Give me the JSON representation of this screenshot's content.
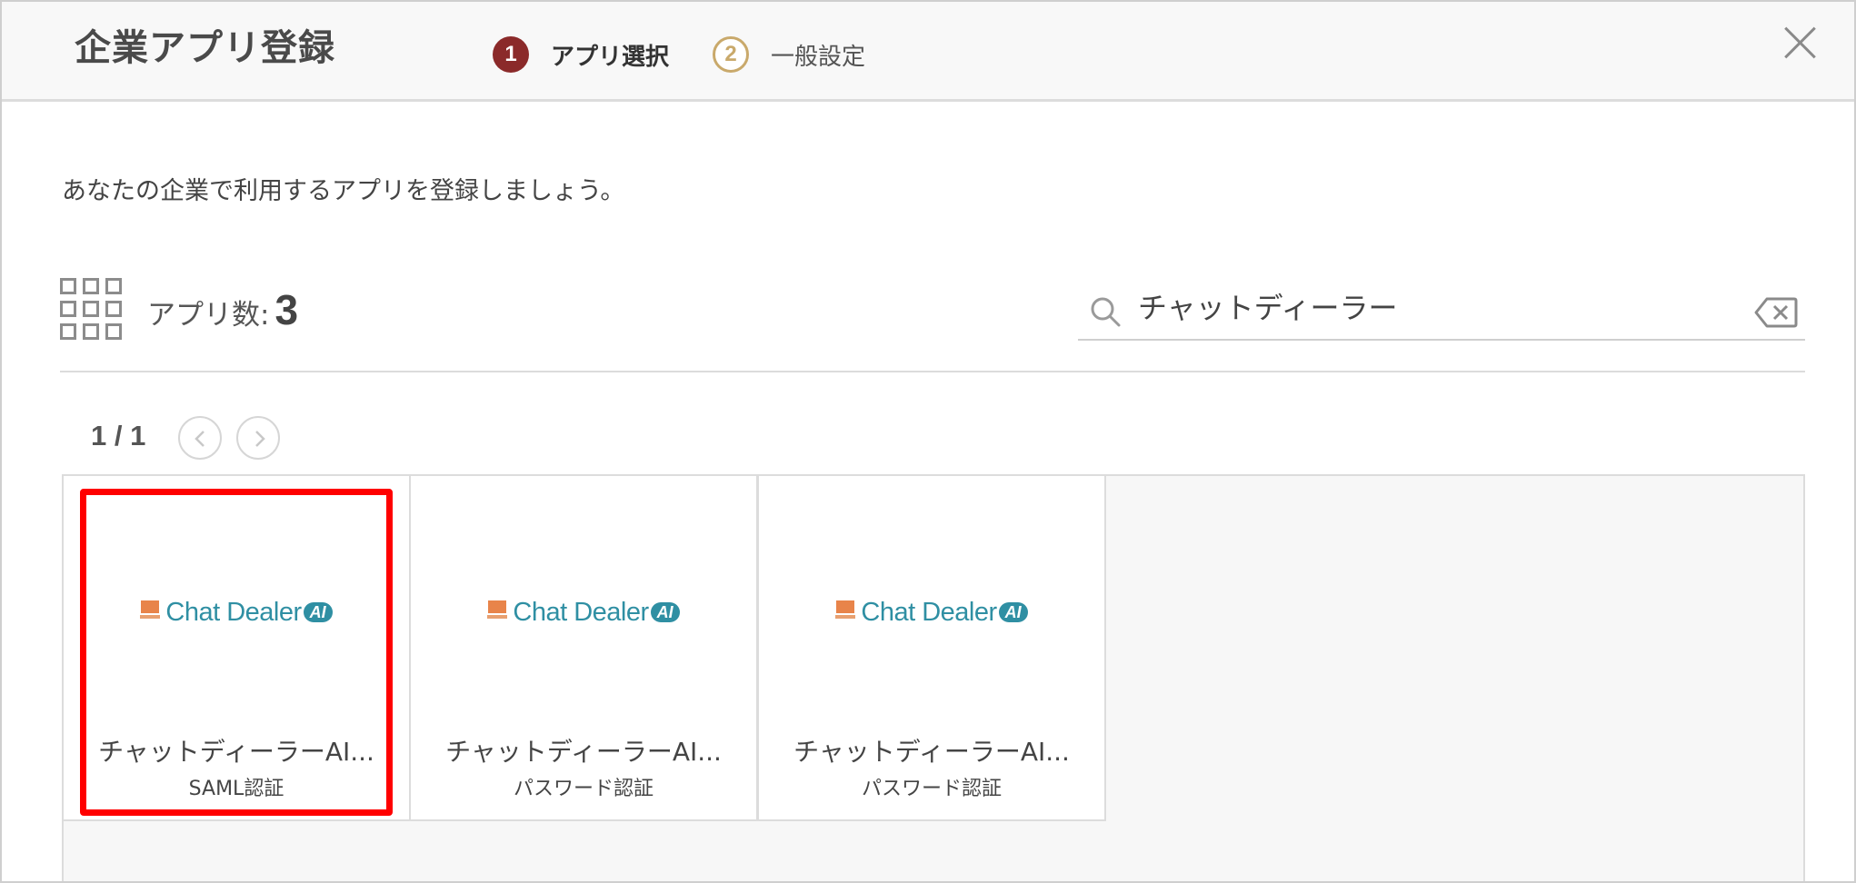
{
  "header": {
    "title": "企業アプリ登録",
    "steps": [
      {
        "number": "1",
        "label": "アプリ選択",
        "active": true
      },
      {
        "number": "2",
        "label": "一般設定",
        "active": false
      }
    ]
  },
  "description": "あなたの企業で利用するアプリを登録しましょう。",
  "app_count": {
    "label": "アプリ数:",
    "value": "3"
  },
  "search": {
    "value": "チャットディーラー"
  },
  "pagination": {
    "indicator": "1 / 1"
  },
  "cards": [
    {
      "logo_text": "Chat Dealer",
      "logo_badge": "AI",
      "name": "チャットディーラーAI...",
      "auth": "SAML認証",
      "selected": true
    },
    {
      "logo_text": "Chat Dealer",
      "logo_badge": "AI",
      "name": "チャットディーラーAI...",
      "auth": "パスワード認証",
      "selected": false
    },
    {
      "logo_text": "Chat Dealer",
      "logo_badge": "AI",
      "name": "チャットディーラーAI...",
      "auth": "パスワード認証",
      "selected": false
    }
  ],
  "colors": {
    "active_step": "#8b2a2a",
    "inactive_step": "#c9a96b",
    "logo_teal": "#2f8fa3",
    "logo_orange": "#e8844a",
    "highlight": "#ff0000"
  }
}
